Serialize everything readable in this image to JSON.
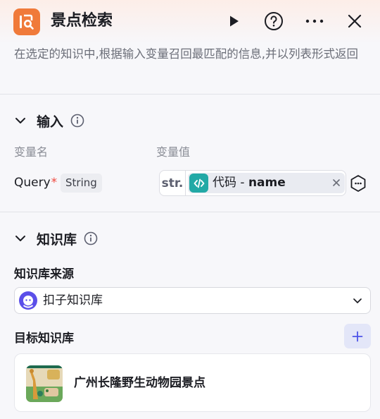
{
  "header": {
    "title": "景点检索",
    "icon": "knowledge-search-icon",
    "accent_color": "#F07A3A"
  },
  "description": "在选定的知识中,根据输入变量召回最匹配的信息,并以列表形式返回",
  "input_section": {
    "title": "输入",
    "col_name_label": "变量名",
    "col_value_label": "变量值",
    "param": {
      "name": "Query",
      "required_mark": "*",
      "type": "String",
      "value_type_tag": "str.",
      "ref_source": "代码",
      "ref_separator": " - ",
      "ref_field": "name"
    }
  },
  "knowledge_section": {
    "title": "知识库",
    "source_label": "知识库来源",
    "source_value": "扣子知识库",
    "target_label": "目标知识库",
    "add_label": "+",
    "items": [
      {
        "name": "广州长隆野生动物园景点"
      }
    ]
  }
}
